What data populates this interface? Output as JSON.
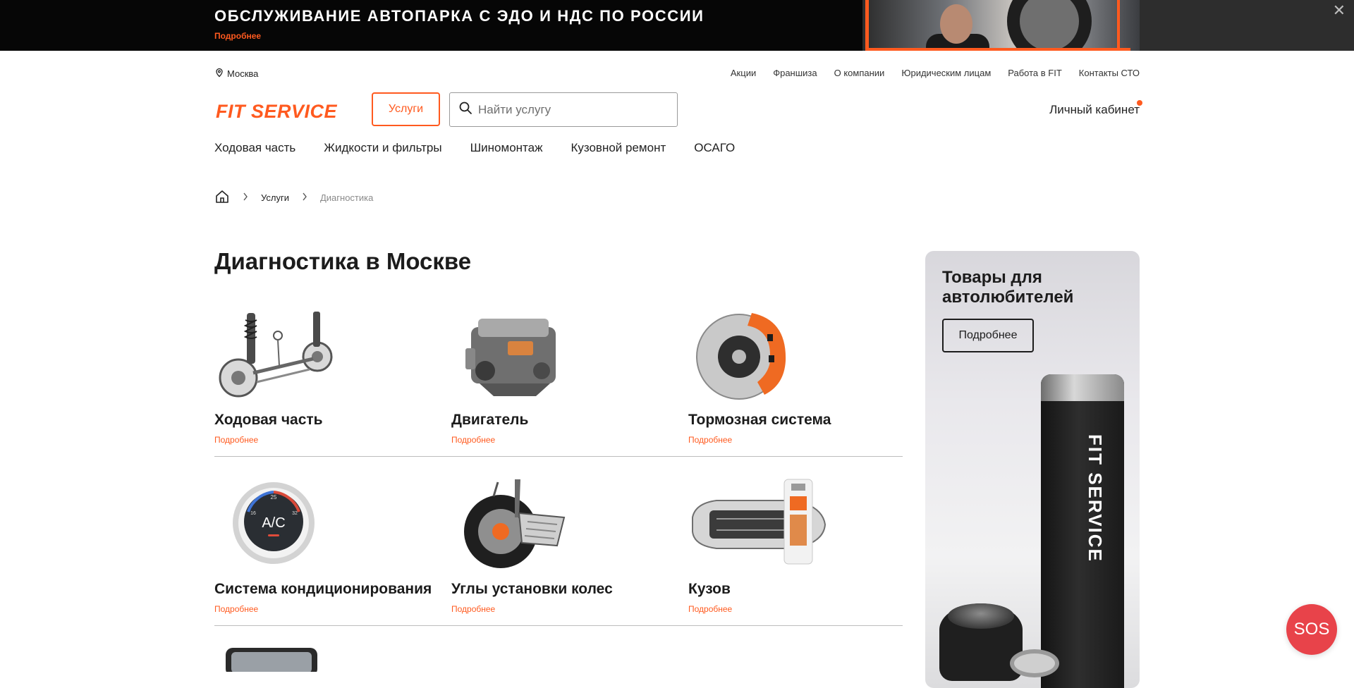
{
  "promo": {
    "title": "ОБСЛУЖИВАНИЕ АВТОПАРКА С ЭДО И НДС ПО РОССИИ",
    "link": "Подробнее",
    "close": "✕"
  },
  "topbar": {
    "city": "Москва",
    "links": [
      "Акции",
      "Франшиза",
      "О компании",
      "Юридическим лицам",
      "Работа в FIT",
      "Контакты СТО"
    ]
  },
  "header": {
    "logo": "FIT SERVICE",
    "services_label": "Услуги",
    "search_placeholder": "Найти услугу",
    "account_label": "Личный кабинет"
  },
  "catnav": [
    "Ходовая часть",
    "Жидкости и фильтры",
    "Шиномонтаж",
    "Кузовной ремонт",
    "ОСАГО"
  ],
  "breadcrumb": {
    "items": [
      "Услуги",
      "Диагностика"
    ]
  },
  "page": {
    "title": "Диагностика в Москве"
  },
  "cards": [
    {
      "name": "Ходовая часть",
      "more": "Подробнее",
      "icon": "suspension"
    },
    {
      "name": "Двигатель",
      "more": "Подробнее",
      "icon": "engine"
    },
    {
      "name": "Тормозная система",
      "more": "Подробнее",
      "icon": "brake"
    },
    {
      "name": "Система кондиционирования",
      "more": "Подробнее",
      "icon": "ac-gauge"
    },
    {
      "name": "Углы установки колес",
      "more": "Подробнее",
      "icon": "wheel-alignment"
    },
    {
      "name": "Кузов",
      "more": "Подробнее",
      "icon": "car-body"
    }
  ],
  "ac_gauge": {
    "label": "A/C",
    "ticks": [
      "16",
      "25",
      "32"
    ]
  },
  "promo_card": {
    "title": "Товары для автолюбителей",
    "button": "Подробнее",
    "bottle_text": "FIT SERVICE"
  },
  "sos": "SOS",
  "colors": {
    "accent": "#ff5a1f",
    "sos": "#e8434a",
    "banner_bg": "#060606"
  }
}
